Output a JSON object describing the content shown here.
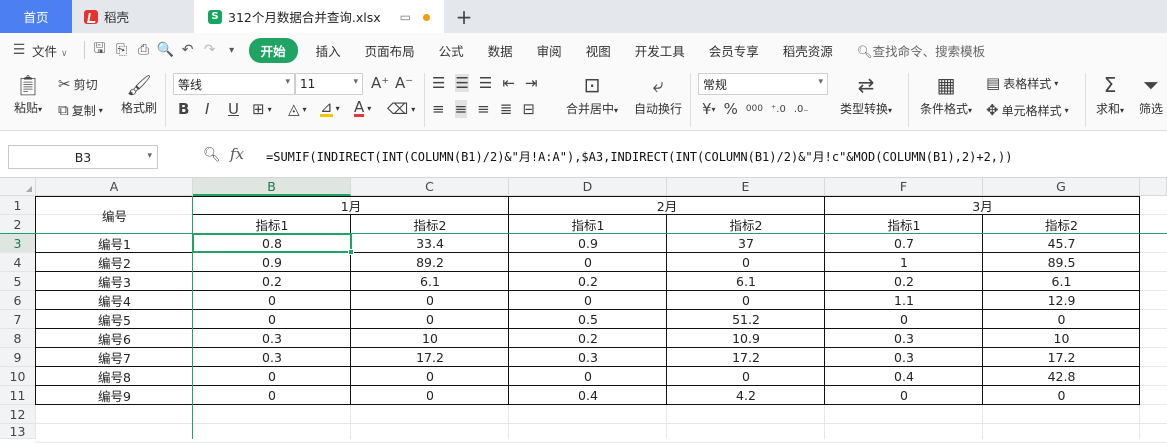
{
  "tabs": {
    "home": "首页",
    "docer": "稻壳",
    "file": "312个月数据合并查询.xlsx",
    "add": "+"
  },
  "menu": {
    "file": "文件",
    "start": "开始",
    "items": [
      "插入",
      "页面布局",
      "公式",
      "数据",
      "审阅",
      "视图",
      "开发工具",
      "会员专享",
      "稻壳资源"
    ],
    "search": "查找命令、搜索模板"
  },
  "ribbon": {
    "paste": "粘贴",
    "cut": "剪切",
    "copy": "复制",
    "format_painter": "格式刷",
    "font_name": "等线",
    "font_size": "11",
    "merge_center": "合并居中",
    "wrap_text": "自动换行",
    "number_format": "常规",
    "type_convert": "类型转换",
    "conditional_format": "条件格式",
    "table_style": "表格样式",
    "cell_style": "单元格样式",
    "sum": "求和",
    "filter": "筛选",
    "percent": "%",
    "thousands": "000",
    "currency": "¥"
  },
  "formula_bar": {
    "name_box": "B3",
    "fx": "fx",
    "formula": "=SUMIF(INDIRECT(INT(COLUMN(B1)/2)&\"月!A:A\"),$A3,INDIRECT(INT(COLUMN(B1)/2)&\"月!c\"&MOD(COLUMN(B1),2)+2,))"
  },
  "sheet": {
    "columns": [
      "A",
      "B",
      "C",
      "D",
      "E",
      "F",
      "G"
    ],
    "rows": [
      "1",
      "2",
      "3",
      "4",
      "5",
      "6",
      "7",
      "8",
      "9",
      "10",
      "11",
      "12",
      "13"
    ],
    "selected_cell": "B3",
    "header_label": "编号",
    "months": [
      "1月",
      "2月",
      "3月"
    ],
    "indicators": [
      "指标1",
      "指标2",
      "指标1",
      "指标2",
      "指标1",
      "指标2"
    ],
    "data": [
      [
        "编号1",
        "0.8",
        "33.4",
        "0.9",
        "37",
        "0.7",
        "45.7"
      ],
      [
        "编号2",
        "0.9",
        "89.2",
        "0",
        "0",
        "1",
        "89.5"
      ],
      [
        "编号3",
        "0.2",
        "6.1",
        "0.2",
        "6.1",
        "0.2",
        "6.1"
      ],
      [
        "编号4",
        "0",
        "0",
        "0",
        "0",
        "1.1",
        "12.9"
      ],
      [
        "编号5",
        "0",
        "0",
        "0.5",
        "51.2",
        "0",
        "0"
      ],
      [
        "编号6",
        "0.3",
        "10",
        "0.2",
        "10.9",
        "0.3",
        "10"
      ],
      [
        "编号7",
        "0.3",
        "17.2",
        "0.3",
        "17.2",
        "0.3",
        "17.2"
      ],
      [
        "编号8",
        "0",
        "0",
        "0",
        "0",
        "0.4",
        "42.8"
      ],
      [
        "编号9",
        "0",
        "0",
        "0.4",
        "4.2",
        "0",
        "0"
      ]
    ]
  }
}
